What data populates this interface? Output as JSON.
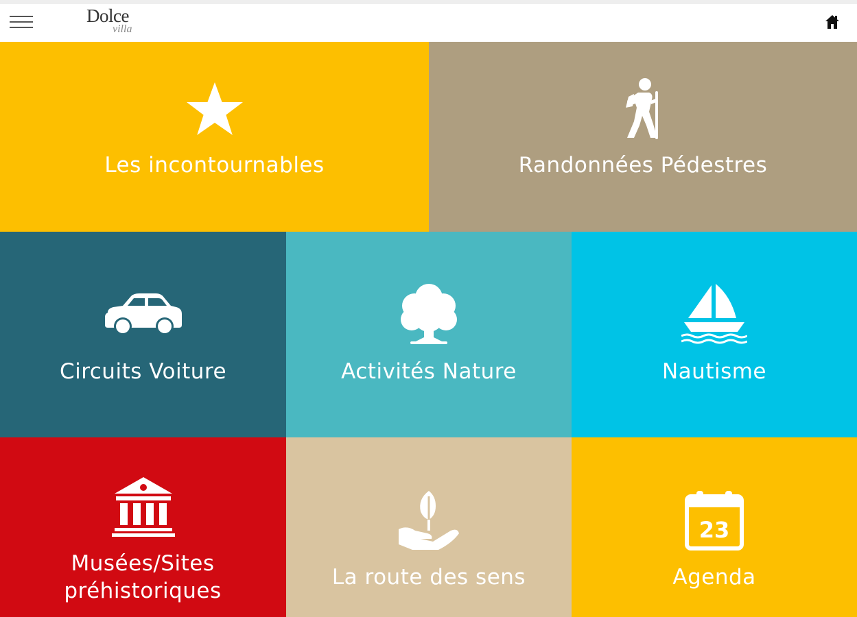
{
  "header": {
    "logo_main": "Dolce",
    "logo_sub": "villa"
  },
  "icons": {
    "menu": "hamburger-menu-icon",
    "home": "home-icon"
  },
  "tiles": [
    {
      "label": "Les incontournables",
      "icon": "star-icon",
      "color": "#FDBF00"
    },
    {
      "label": "Randonnées Pédestres",
      "icon": "hiker-icon",
      "color": "#AE9E80"
    },
    {
      "label": "Circuits Voiture",
      "icon": "car-icon",
      "color": "#266677"
    },
    {
      "label": "Activités Nature",
      "icon": "tree-icon",
      "color": "#4AB8C1"
    },
    {
      "label": "Nautisme",
      "icon": "sailboat-icon",
      "color": "#00C3E6"
    },
    {
      "label": "Musées/Sites préhistoriques",
      "icon": "museum-icon",
      "color": "#D10A12"
    },
    {
      "label": "La route des sens",
      "icon": "hand-plant-icon",
      "color": "#D9C4A0"
    },
    {
      "label": "Agenda",
      "icon": "calendar-icon",
      "color": "#FDBF00",
      "calendar_day": "23"
    }
  ]
}
